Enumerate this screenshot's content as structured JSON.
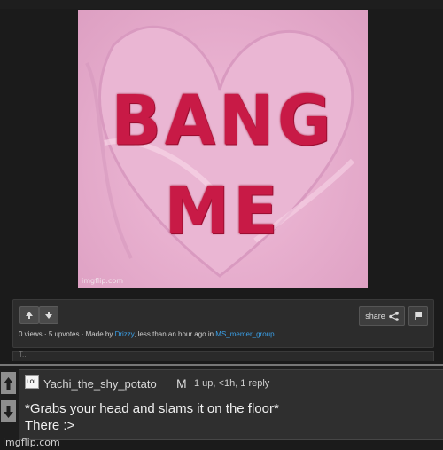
{
  "meme": {
    "line1": "BANG",
    "line2": "ME",
    "watermark": "imgflip.com"
  },
  "post": {
    "share_label": "share",
    "views": "0 views",
    "upvotes": "5 upvotes",
    "made_by_prefix": "Made by",
    "author": "Drizzy",
    "time": "less than an hour ago in",
    "stream": "MS_memer_group"
  },
  "mid_strip": {
    "text": "T..."
  },
  "comment": {
    "badge": "LOL",
    "username": "Yachi_the_shy_potato",
    "mod_badge": "M",
    "meta": "1 up, <1h, 1 reply",
    "line1": "*Grabs your head and slams it on the floor*",
    "line2": "There :>"
  },
  "footer": {
    "watermark": "imgflip.com"
  },
  "colors": {
    "link": "#3aa0e8",
    "meme_text": "#c81a46",
    "meme_bg": "#e8b0cf"
  }
}
